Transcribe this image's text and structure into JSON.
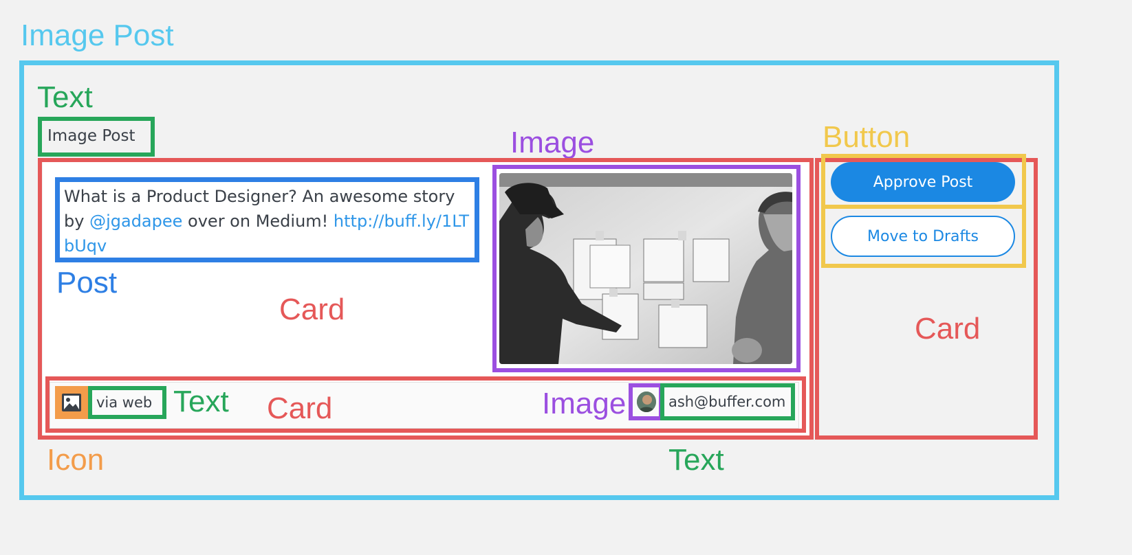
{
  "labels": {
    "title": "Image Post",
    "text_top": "Text",
    "image_top": "Image",
    "button": "Button",
    "post": "Post",
    "card_left": "Card",
    "card_right": "Card",
    "card_bottom": "Card",
    "text_footer": "Text",
    "image_footer": "Image",
    "icon": "Icon",
    "text_bottom": "Text"
  },
  "post_card": {
    "heading": "Image Post",
    "text_plain_1": "What is a Product Designer? An awesome story by ",
    "mention": "@jgadapee",
    "text_plain_2": " over on Medium! ",
    "link": "http://buff.ly/1LTbUqv"
  },
  "footer": {
    "via": "via web",
    "email": "ash@buffer.com"
  },
  "buttons": {
    "approve": "Approve Post",
    "drafts": "Move to Drafts"
  },
  "icons": [
    "image-icon",
    "avatar"
  ],
  "colors": {
    "annotation_blue": "#56c8ee",
    "annotation_green": "#27a65a",
    "annotation_purple": "#9b4fe0",
    "annotation_yellow": "#f1c84c",
    "annotation_red": "#e55858",
    "annotation_post": "#2e7fe4",
    "annotation_orange": "#f39c4a",
    "button_blue": "#1b88e3"
  }
}
